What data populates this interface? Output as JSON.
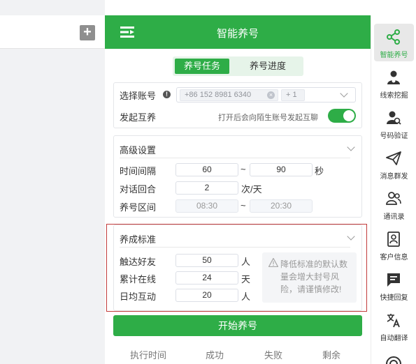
{
  "panel": {
    "title": "智能养号",
    "tabs": [
      {
        "label": "养号任务",
        "active": true
      },
      {
        "label": "养号进度",
        "active": false
      }
    ]
  },
  "account": {
    "label": "选择账号",
    "tags": [
      "+86 152 8981 6340",
      "+ 1"
    ]
  },
  "mutual": {
    "label": "发起互养",
    "hint": "打开后会向陌生账号发起互聊",
    "enabled": true
  },
  "advanced": {
    "title": "高级设置",
    "interval_label": "时间间隔",
    "interval_min": "60",
    "interval_tilde": "~",
    "interval_max": "90",
    "interval_unit": "秒",
    "rounds_label": "对话回合",
    "rounds_value": "2",
    "rounds_unit": "次/天",
    "range_label": "养号区间",
    "range_start": "08:30",
    "range_tilde": "~",
    "range_end": "20:30"
  },
  "standard": {
    "title": "养成标准",
    "friends_label": "触达好友",
    "friends_value": "50",
    "friends_unit": "人",
    "online_label": "累计在线",
    "online_value": "24",
    "online_unit": "天",
    "interact_label": "日均互动",
    "interact_value": "20",
    "interact_unit": "人",
    "warning": "降低标准的默认数量会增大封号风险，请谨慎修改!"
  },
  "start_button": "开始养号",
  "footer": [
    "执行时间",
    "成功",
    "失败",
    "剩余"
  ],
  "sidebar": [
    {
      "label": "智能养号",
      "icon": "share-icon",
      "active": true
    },
    {
      "label": "线索挖掘",
      "icon": "user-search-icon",
      "active": false
    },
    {
      "label": "号码验证",
      "icon": "user-verify-icon",
      "active": false
    },
    {
      "label": "消息群发",
      "icon": "send-icon",
      "active": false
    },
    {
      "label": "通讯录",
      "icon": "contacts-icon",
      "active": false
    },
    {
      "label": "客户信息",
      "icon": "customer-info-icon",
      "active": false
    },
    {
      "label": "快捷回复",
      "icon": "quick-reply-icon",
      "active": false
    },
    {
      "label": "自动翻译",
      "icon": "translate-icon",
      "active": false
    }
  ],
  "colors": {
    "accent": "#2ead47",
    "highlight_border": "#c23b3b"
  }
}
